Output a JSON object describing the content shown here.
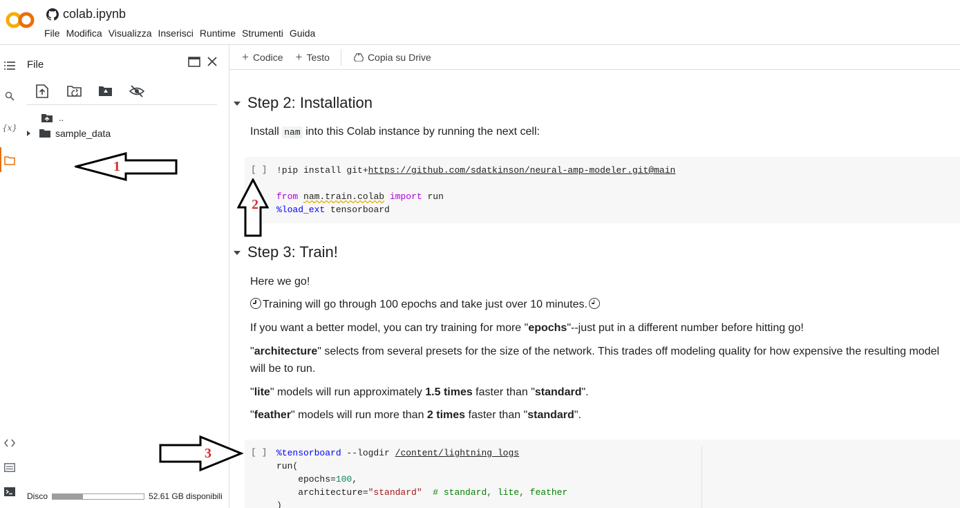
{
  "app": {
    "logo": "CO",
    "title": "colab.ipynb",
    "menu": [
      "File",
      "Modifica",
      "Visualizza",
      "Inserisci",
      "Runtime",
      "Strumenti",
      "Guida"
    ]
  },
  "rail_icons": [
    "toc-icon",
    "search-icon",
    "variables-icon",
    "folder-icon",
    "code-snippets-icon",
    "command-palette-icon",
    "terminal-icon"
  ],
  "file_panel": {
    "title": "File",
    "tree": {
      "up": "..",
      "folder": "sample_data"
    },
    "disk_label": "Disco",
    "disk_free": "52.61 GB disponibili",
    "disk_used_fraction": 0.33
  },
  "toolbar": {
    "add_code": "Codice",
    "add_text": "Testo",
    "copy_drive": "Copia su Drive"
  },
  "notebook": {
    "step2": {
      "heading": "Step 2: Installation",
      "text_pre": "Install ",
      "text_code": "nam",
      "text_post": " into this Colab instance by running the next cell:",
      "cell_bracket": "[ ]",
      "line1_cmd": "!pip install git+",
      "line1_url": "https://github.com/sdatkinson/neural-amp-modeler.git@main",
      "line3_from": "from",
      "line3_mod": "nam.train.colab",
      "line3_import": "import",
      "line3_name": "run",
      "line4_magic": "%load_ext",
      "line4_arg": "tensorboard"
    },
    "step3": {
      "heading": "Step 3: Train!",
      "p1": "Here we go!",
      "p2": "Training will go through 100 epochs and take just over 10 minutes.",
      "p3_a": "If you want a better model, you can try training for more \"",
      "p3_b": "epochs",
      "p3_c": "\"--just put in a different number before hitting go!",
      "p4_a": "\"",
      "p4_b": "architecture",
      "p4_c": "\" selects from several presets for the size of the network. This trades off modeling quality for how expensive the resulting model will be to run.",
      "p5_a": "\"",
      "p5_b": "lite",
      "p5_c": "\" models will run approximately ",
      "p5_d": "1.5 times",
      "p5_e": " faster than \"",
      "p5_f": "standard",
      "p5_g": "\".",
      "p6_a": "\"",
      "p6_b": "feather",
      "p6_c": "\" models will run more than ",
      "p6_d": "2 times",
      "p6_e": " faster than \"",
      "p6_f": "standard",
      "p6_g": "\".",
      "cell_bracket": "[ ]",
      "c1_magic": "%tensorboard",
      "c1_arg": " --logdir ",
      "c1_path": "/content/lightning_logs",
      "c2": "run(",
      "c3_key": "    epochs=",
      "c3_val": "100",
      "c3_end": ",",
      "c4_key": "    architecture=",
      "c4_val": "\"standard\"",
      "c4_comment": "  # standard, lite, feather",
      "c5": ")"
    }
  },
  "annotations": [
    "1",
    "2",
    "3"
  ]
}
